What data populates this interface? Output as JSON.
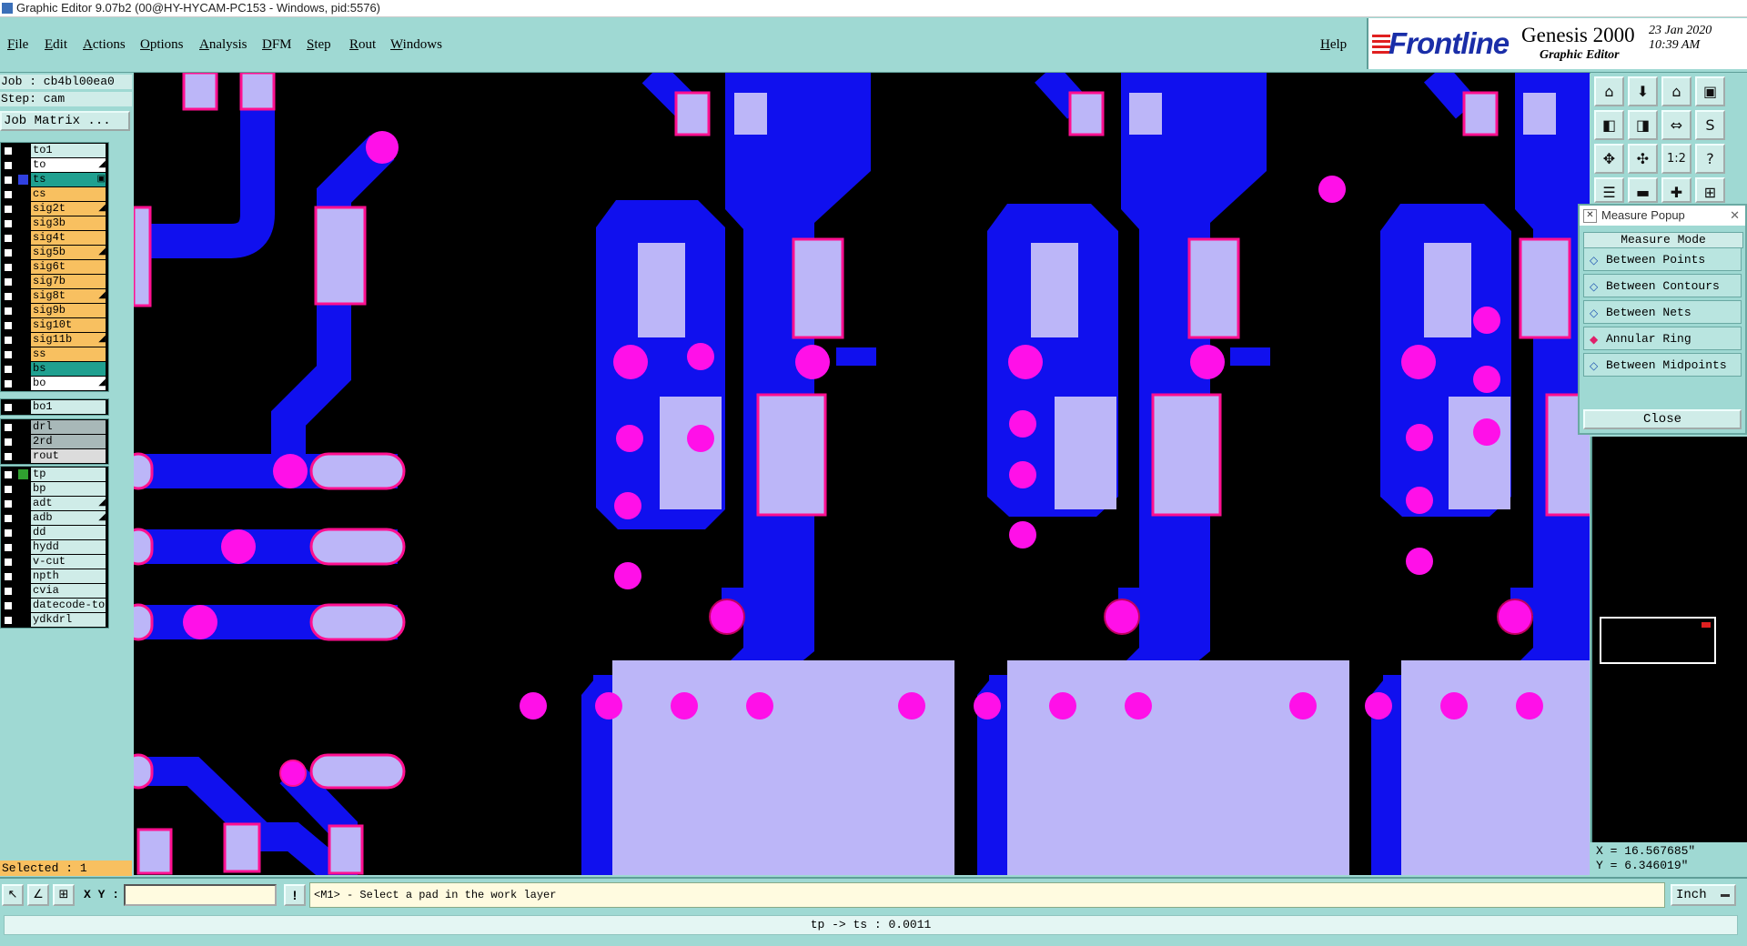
{
  "window": {
    "title": "Graphic Editor 9.07b2 (00@HY-HYCAM-PC153 - Windows, pid:5576)"
  },
  "menu": {
    "items": [
      "File",
      "Edit",
      "Actions",
      "Options",
      "Analysis",
      "DFM",
      "Step",
      "Rout",
      "Windows"
    ],
    "help": "Help"
  },
  "brand": {
    "logo": "Frontline",
    "product": "Genesis 2000",
    "subtitle": "Graphic Editor",
    "date": "23 Jan 2020",
    "time": "10:39 AM"
  },
  "job": {
    "job_label": "Job : cb4bl00ea0",
    "step_label": "Step: cam",
    "matrix_button": "Job Matrix ..."
  },
  "layers": {
    "group1": [
      {
        "name": "to1",
        "color": "#cfece8",
        "flag": ""
      },
      {
        "name": "to",
        "color": "#ffffff",
        "flag": "◢"
      },
      {
        "name": "ts",
        "color": "#20a090",
        "flag": "▣",
        "marker": "#3040e0",
        "active": true
      },
      {
        "name": "cs",
        "color": "#f8c060",
        "flag": ""
      },
      {
        "name": "sig2t",
        "color": "#f8c060",
        "flag": "◢"
      },
      {
        "name": "sig3b",
        "color": "#f8c060",
        "flag": ""
      },
      {
        "name": "sig4t",
        "color": "#f8c060",
        "flag": ""
      },
      {
        "name": "sig5b",
        "color": "#f8c060",
        "flag": "◢"
      },
      {
        "name": "sig6t",
        "color": "#f8c060",
        "flag": ""
      },
      {
        "name": "sig7b",
        "color": "#f8c060",
        "flag": ""
      },
      {
        "name": "sig8t",
        "color": "#f8c060",
        "flag": "◢"
      },
      {
        "name": "sig9b",
        "color": "#f8c060",
        "flag": ""
      },
      {
        "name": "sig10t",
        "color": "#f8c060",
        "flag": ""
      },
      {
        "name": "sig11b",
        "color": "#f8c060",
        "flag": "◢"
      },
      {
        "name": "ss",
        "color": "#f8c060",
        "flag": ""
      },
      {
        "name": "bs",
        "color": "#20a090",
        "flag": ""
      },
      {
        "name": "bo",
        "color": "#ffffff",
        "flag": "◢"
      }
    ],
    "group2": [
      {
        "name": "bo1",
        "color": "#cfece8",
        "flag": ""
      }
    ],
    "group3": [
      {
        "name": "drl",
        "color": "#a8b8b8",
        "flag": ""
      },
      {
        "name": "2rd",
        "color": "#a8b8b8",
        "flag": ""
      },
      {
        "name": "rout",
        "color": "#dcdcdc",
        "flag": ""
      }
    ],
    "group4": [
      {
        "name": "tp",
        "color": "#cfece8",
        "flag": "",
        "marker": "#30a030"
      },
      {
        "name": "bp",
        "color": "#cfece8",
        "flag": ""
      },
      {
        "name": "adt",
        "color": "#cfece8",
        "flag": "◢"
      },
      {
        "name": "adb",
        "color": "#cfece8",
        "flag": "◢"
      },
      {
        "name": "dd",
        "color": "#cfece8",
        "flag": ""
      },
      {
        "name": "hydd",
        "color": "#cfece8",
        "flag": ""
      },
      {
        "name": "v-cut",
        "color": "#cfece8",
        "flag": ""
      },
      {
        "name": "npth",
        "color": "#cfece8",
        "flag": ""
      },
      {
        "name": "cvia",
        "color": "#cfece8",
        "flag": ""
      },
      {
        "name": "datecode-to",
        "color": "#cfece8",
        "flag": ""
      },
      {
        "name": "ydkdrl",
        "color": "#cfece8",
        "flag": ""
      }
    ],
    "selected_label": "Selected : 1"
  },
  "measure": {
    "title": "Measure Popup",
    "header": "Measure Mode",
    "options": [
      "Between Points",
      "Between Contours",
      "Between Nets",
      "Annular Ring",
      "Between Midpoints"
    ],
    "selected": "Annular Ring",
    "close": "Close"
  },
  "coords": {
    "x": "X = 16.567685\"",
    "y": "Y = 6.346019\""
  },
  "bottom": {
    "xy_label": "X Y :",
    "xy_value": "",
    "prompt": "<M1> - Select a pad in the work layer",
    "units": "Inch"
  },
  "status": {
    "text": "tp -> ts : 0.0011"
  },
  "colors": {
    "copper": "#1010ee",
    "pad": "#bcb6f8",
    "pad_outline": "#ff1090",
    "via": "#ff10e8",
    "background": "#000000",
    "panel": "#9fd9d3"
  }
}
